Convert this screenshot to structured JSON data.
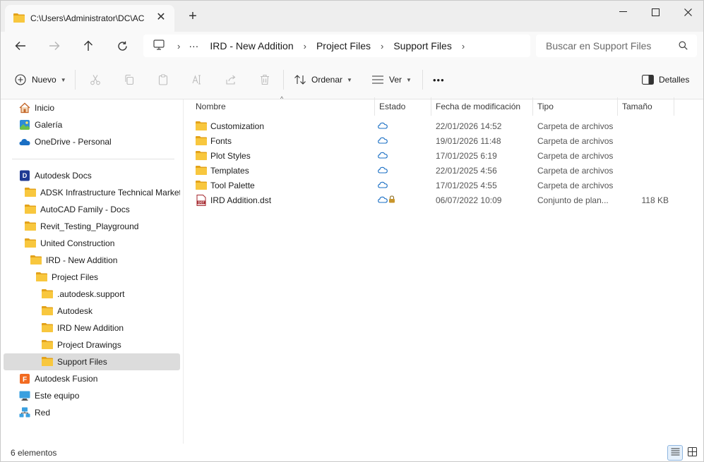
{
  "tab": {
    "title": "C:\\Users\\Administrator\\DC\\AC"
  },
  "address": {
    "more": "···",
    "crumbs": [
      "IRD - New Addition",
      "Project Files",
      "Support Files"
    ]
  },
  "search": {
    "placeholder": "Buscar en Support Files"
  },
  "toolbar": {
    "new_label": "Nuevo",
    "sort_label": "Ordenar",
    "view_label": "Ver",
    "more_label": "•••",
    "details_label": "Detalles"
  },
  "sidebar": {
    "quick": [
      {
        "label": "Inicio",
        "icon": "home-icon"
      },
      {
        "label": "Galería",
        "icon": "gallery-icon"
      },
      {
        "label": "OneDrive - Personal",
        "icon": "onedrive-icon"
      }
    ],
    "tree": [
      {
        "label": "Autodesk Docs",
        "icon": "autodesk-docs-icon",
        "indent": 0
      },
      {
        "label": "ADSK Infrastructure Technical Marketi",
        "icon": "folder-icon",
        "indent": 1
      },
      {
        "label": "AutoCAD Family - Docs",
        "icon": "folder-icon",
        "indent": 1
      },
      {
        "label": "Revit_Testing_Playground",
        "icon": "folder-icon",
        "indent": 1
      },
      {
        "label": "United Construction",
        "icon": "folder-icon",
        "indent": 1
      },
      {
        "label": "IRD - New Addition",
        "icon": "folder-icon",
        "indent": 2
      },
      {
        "label": "Project Files",
        "icon": "folder-icon",
        "indent": 3
      },
      {
        "label": ".autodesk.support",
        "icon": "folder-icon",
        "indent": 4
      },
      {
        "label": "Autodesk",
        "icon": "folder-icon",
        "indent": 4
      },
      {
        "label": "IRD New Addition",
        "icon": "folder-icon",
        "indent": 4
      },
      {
        "label": "Project Drawings",
        "icon": "folder-icon",
        "indent": 4
      },
      {
        "label": "Support Files",
        "icon": "folder-icon",
        "indent": 4,
        "selected": true
      },
      {
        "label": "Autodesk Fusion",
        "icon": "fusion-icon",
        "indent": 0
      },
      {
        "label": "Este equipo",
        "icon": "computer-icon",
        "indent": 0
      },
      {
        "label": "Red",
        "icon": "network-icon",
        "indent": 0
      }
    ]
  },
  "columns": {
    "name": "Nombre",
    "status": "Estado",
    "modified": "Fecha de modificación",
    "type": "Tipo",
    "size": "Tamaño"
  },
  "files": [
    {
      "name": "Customization",
      "status": "cloud",
      "modified": "22/01/2026 14:52",
      "type": "Carpeta de archivos",
      "size": "",
      "kind": "folder"
    },
    {
      "name": "Fonts",
      "status": "cloud",
      "modified": "19/01/2026 11:48",
      "type": "Carpeta de archivos",
      "size": "",
      "kind": "folder"
    },
    {
      "name": "Plot Styles",
      "status": "cloud",
      "modified": "17/01/2025 6:19",
      "type": "Carpeta de archivos",
      "size": "",
      "kind": "folder"
    },
    {
      "name": "Templates",
      "status": "cloud",
      "modified": "22/01/2025 4:56",
      "type": "Carpeta de archivos",
      "size": "",
      "kind": "folder"
    },
    {
      "name": "Tool Palette",
      "status": "cloud",
      "modified": "17/01/2025 4:55",
      "type": "Carpeta de archivos",
      "size": "",
      "kind": "folder"
    },
    {
      "name": "IRD Addition.dst",
      "status": "cloud-locked",
      "modified": "06/07/2022 10:09",
      "type": "Conjunto de plan...",
      "size": "118 KB",
      "kind": "dst"
    }
  ],
  "status": {
    "count": "6 elementos"
  },
  "colors": {
    "folder": "#F8C73E",
    "folder_dark": "#E3A21A",
    "cloud": "#1A6FC4",
    "accent": "#0067C0",
    "dst": "#A4262C"
  }
}
